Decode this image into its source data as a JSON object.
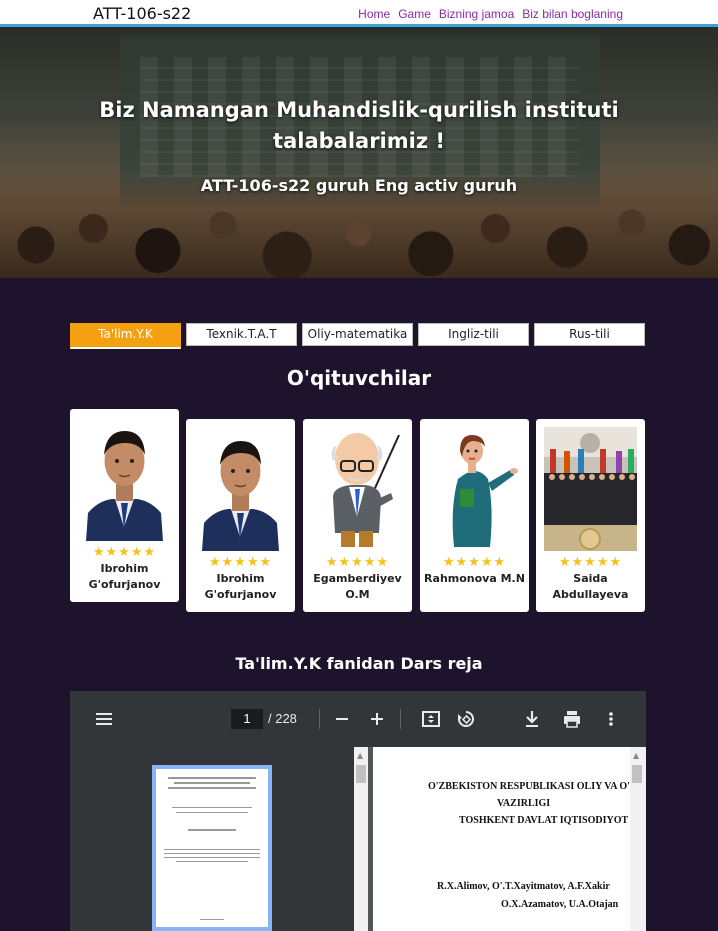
{
  "nav": {
    "brand": "ATT-106-s22",
    "links": [
      "Home",
      "Game",
      "Bizning jamoa",
      "Biz bilan boglaning"
    ]
  },
  "hero": {
    "title_line1": "Biz Namangan Muhandislik-qurilish instituti",
    "title_line2": "talabalarimiz !",
    "subtitle": "ATT-106-s22 guruh Eng activ guruh"
  },
  "tabs": [
    "Ta'lim.Y.K",
    "Texnik.T.A.T",
    "Oliy-matematika",
    "Ingliz-tili",
    "Rus-tili"
  ],
  "active_tab": 0,
  "teachers_title": "O'qituvchilar",
  "teachers": [
    {
      "name_line1": "Ibrohim",
      "name_line2": "G'ofurjanov",
      "stars": "★★★★★",
      "rating": 5
    },
    {
      "name_line1": "Ibrohim",
      "name_line2": "G'ofurjanov",
      "stars": "★★★★★",
      "rating": 5
    },
    {
      "name_line1": "Egamberdiyev",
      "name_line2": "O.M",
      "stars": "★★★★★",
      "rating": 5
    },
    {
      "name_line1": "Rahmonova M.N",
      "name_line2": "",
      "stars": "★★★★★",
      "rating": 5
    },
    {
      "name_line1": "Saida",
      "name_line2": "Abdullayeva",
      "stars": "★★★★★",
      "rating": 5
    }
  ],
  "plan_title": "Ta'lim.Y.K fanidan Dars reja",
  "pdf": {
    "current_page": "1",
    "total_pages": "/ 228",
    "page_text": {
      "line1": "O'ZBEKISTON  RESPUBLIKASI OLIY VA O'",
      "line2": "VAZIRLIGI",
      "line3": "TOSHKENT   DAVLAT IQTISODIYOT",
      "line4": "R.X.Alimov,  O'.T.Xayitmatov,  A.F.Xakir",
      "line5": "O.X.Azamatov, U.A.Otajan"
    }
  },
  "colors": {
    "background": "#1d132c",
    "accent_tab": "#f5a10f",
    "nav_link": "#8a2aa8",
    "stars": "#f3c21b"
  }
}
